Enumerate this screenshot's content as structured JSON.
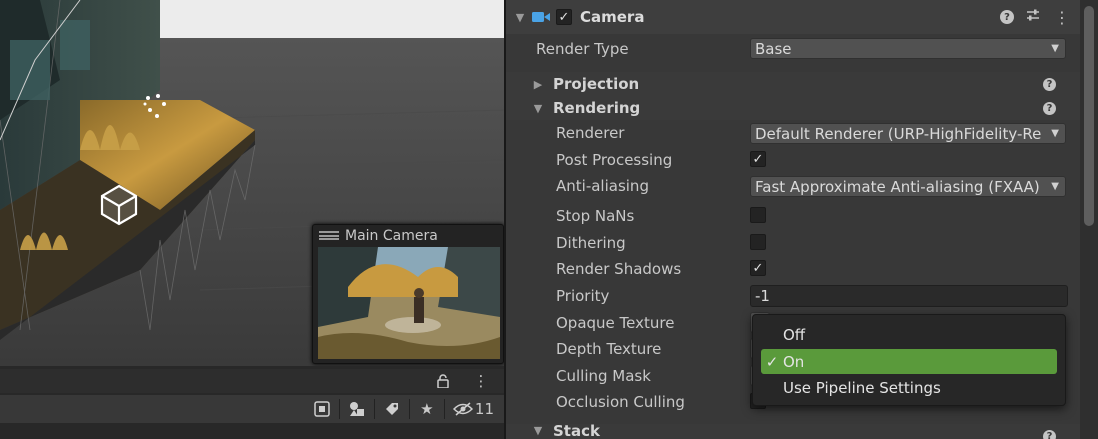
{
  "scene": {
    "camera_preview": {
      "title": "Main Camera"
    },
    "toolbar": {
      "lock_icon": "lock-icon",
      "menu_icon": "kebab-menu-icon",
      "buttons": [
        "scene-visibility-icon",
        "gizmos-shapes-icon",
        "tag-icon",
        "favorite-star-icon"
      ],
      "hidden_count": "11"
    }
  },
  "inspector": {
    "component": {
      "name": "Camera",
      "enabled": true,
      "icons": [
        "help-icon",
        "preset-sliders-icon",
        "kebab-menu-icon"
      ]
    },
    "render_type": {
      "label": "Render Type",
      "value": "Base"
    },
    "sections": {
      "projection": {
        "label": "Projection",
        "expanded": false
      },
      "rendering": {
        "label": "Rendering",
        "expanded": true
      },
      "stack": {
        "label": "Stack"
      }
    },
    "rendering": {
      "renderer": {
        "label": "Renderer",
        "value": "Default Renderer (URP-HighFidelity-Re"
      },
      "post_processing": {
        "label": "Post Processing",
        "checked": true
      },
      "anti_aliasing": {
        "label": "Anti-aliasing",
        "value": "Fast Approximate Anti-aliasing (FXAA)"
      },
      "stop_nans": {
        "label": "Stop NaNs",
        "checked": false
      },
      "dithering": {
        "label": "Dithering",
        "checked": false
      },
      "render_shadows": {
        "label": "Render Shadows",
        "checked": true
      },
      "priority": {
        "label": "Priority",
        "value": "-1"
      },
      "opaque_texture": {
        "label": "Opaque Texture"
      },
      "depth_texture": {
        "label": "Depth Texture"
      },
      "culling_mask": {
        "label": "Culling Mask"
      },
      "occlusion_culling": {
        "label": "Occlusion Culling"
      }
    }
  },
  "popup": {
    "items": [
      {
        "label": "Off",
        "selected": false
      },
      {
        "label": "On",
        "selected": true,
        "check": "✓"
      },
      {
        "label": "Use Pipeline Settings",
        "selected": false
      }
    ]
  },
  "colors": {
    "panel_bg": "#383838",
    "selected_item": "#5a9a3b",
    "field_bg": "#515151"
  }
}
